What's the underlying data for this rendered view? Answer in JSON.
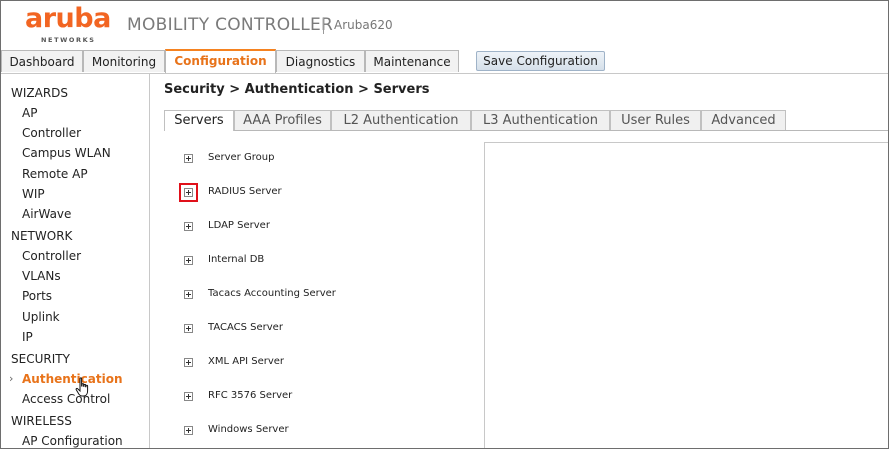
{
  "brand": {
    "logo": "aruba",
    "logo_sub": "NETWORKS",
    "logo_color": "#f26522"
  },
  "header": {
    "title": "MOBILITY CONTROLLER",
    "device": "Aruba620"
  },
  "topnav": {
    "tabs": [
      {
        "label": "Dashboard"
      },
      {
        "label": "Monitoring"
      },
      {
        "label": "Configuration",
        "active": true
      },
      {
        "label": "Diagnostics"
      },
      {
        "label": "Maintenance"
      }
    ],
    "save_label": "Save Configuration"
  },
  "sidebar": {
    "sections": [
      {
        "title": "WIZARDS",
        "items": [
          "AP",
          "Controller",
          "Campus WLAN",
          "Remote AP",
          "WIP",
          "AirWave"
        ]
      },
      {
        "title": "NETWORK",
        "items": [
          "Controller",
          "VLANs",
          "Ports",
          "Uplink",
          "IP"
        ]
      },
      {
        "title": "SECURITY",
        "items": [
          "Authentication",
          "Access Control"
        ]
      },
      {
        "title": "WIRELESS",
        "items": [
          "AP Configuration"
        ]
      }
    ],
    "active_item": "Authentication",
    "active_color": "#e8731a"
  },
  "main": {
    "breadcrumb": "Security > Authentication > Servers",
    "subtabs": [
      {
        "label": "Servers",
        "active": true
      },
      {
        "label": "AAA Profiles"
      },
      {
        "label": "L2 Authentication"
      },
      {
        "label": "L3 Authentication"
      },
      {
        "label": "User Rules"
      },
      {
        "label": "Advanced"
      }
    ],
    "server_tree": [
      "Server Group",
      "RADIUS Server",
      "LDAP Server",
      "Internal DB",
      "Tacacs Accounting Server",
      "TACACS Server",
      "XML API Server",
      "RFC 3576 Server",
      "Windows Server"
    ],
    "highlighted_item": "RADIUS Server",
    "highlight_color": "#e0101a"
  }
}
